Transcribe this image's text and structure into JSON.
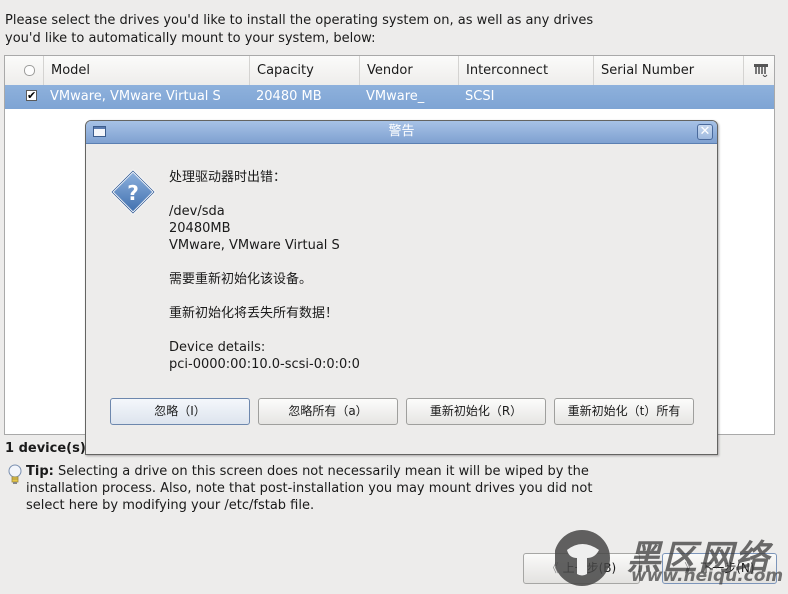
{
  "intro": {
    "line1": "Please select the drives you'd like to install the operating system on, as well as any drives",
    "line2": "you'd like to automatically mount to your system, below:"
  },
  "table": {
    "columns": [
      "Model",
      "Capacity",
      "Vendor",
      "Interconnect",
      "Serial Number"
    ],
    "select_all_checked": false,
    "rows": [
      {
        "checked": true,
        "check_glyph": "✔",
        "model": "VMware, VMware Virtual S",
        "capacity": "20480 MB",
        "vendor": "VMware_",
        "interconnect": "SCSI",
        "serial": ""
      }
    ],
    "selected_row_color": "#86abd9"
  },
  "status": {
    "text": "1 device(s)"
  },
  "tip": {
    "label": "Tip:",
    "text": " Selecting a drive on this screen does not necessarily mean it will be wiped by the installation process.  Also, note that post-installation you may mount drives you did not select here by modifying your /etc/fstab file."
  },
  "nav": {
    "back_label": "上一步(B)",
    "next_label": "下一步(N)"
  },
  "watermark": {
    "title": "黑区网络",
    "url": "www.heiqu.com"
  },
  "dialog": {
    "title": "警告",
    "close_glyph": "✕",
    "icon": "question-icon",
    "lines": [
      "处理驱动器时出错：",
      "",
      "/dev/sda",
      "20480MB",
      "VMware, VMware Virtual S",
      "",
      "需要重新初始化该设备。",
      "",
      "重新初始化将丢失所有数据！",
      "",
      "Device details:",
      "pci-0000:00:10.0-scsi-0:0:0:0"
    ],
    "buttons": [
      {
        "label": "忽略（I）",
        "default": true
      },
      {
        "label": "忽略所有（a）",
        "default": false
      },
      {
        "label": "重新初始化（R）",
        "default": false
      },
      {
        "label": "重新初始化（t）所有",
        "default": false
      }
    ],
    "accent": "#7fa1d1"
  }
}
